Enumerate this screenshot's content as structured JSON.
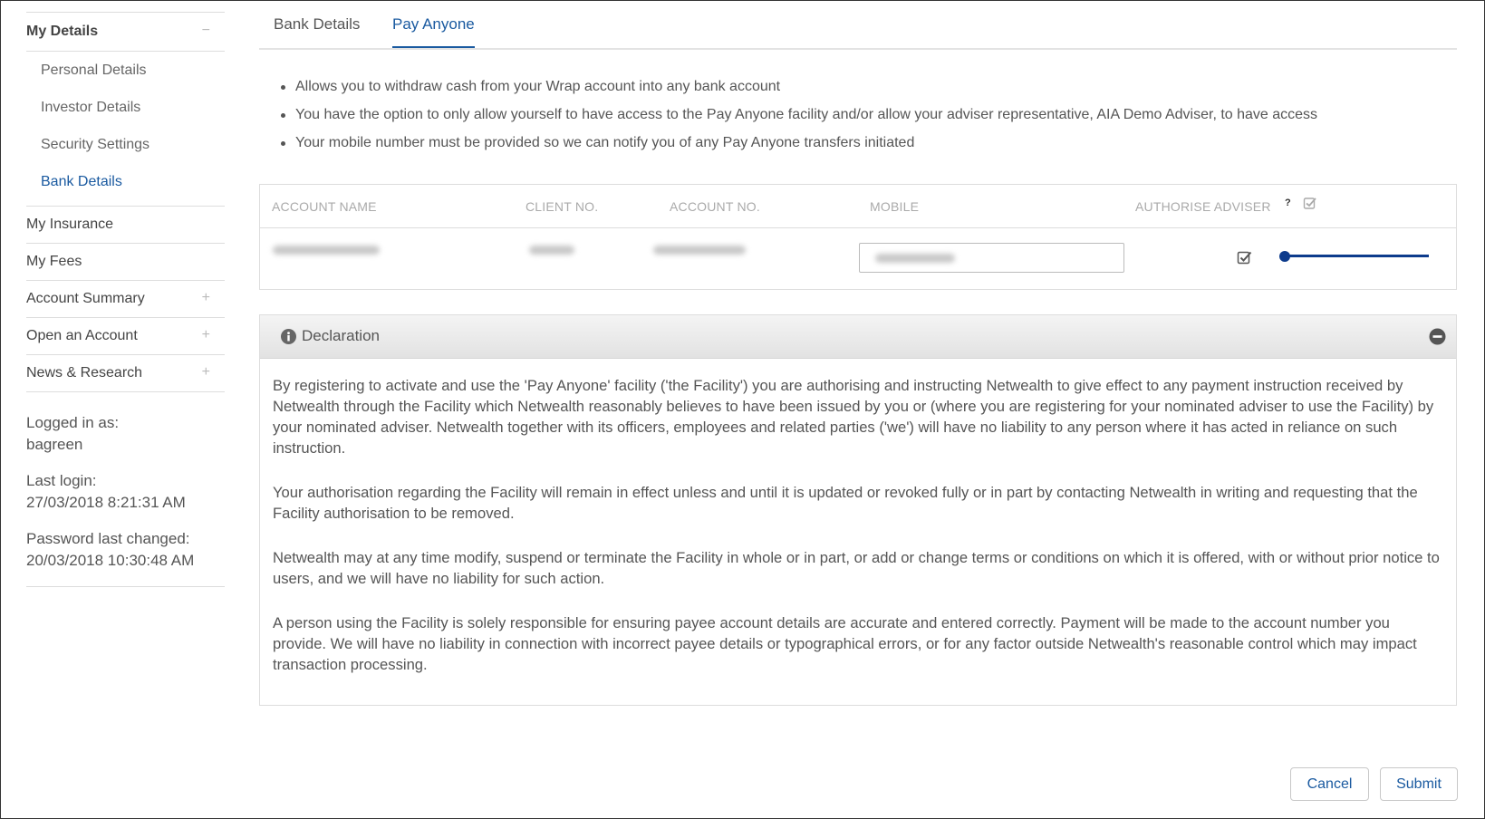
{
  "sidebar": {
    "my_details": {
      "label": "My Details",
      "toggle": "−"
    },
    "sub_items": [
      {
        "label": "Personal Details"
      },
      {
        "label": "Investor Details"
      },
      {
        "label": "Security Settings"
      },
      {
        "label": "Bank Details"
      }
    ],
    "main_items": [
      {
        "label": "My Insurance",
        "toggle": ""
      },
      {
        "label": "My Fees",
        "toggle": ""
      },
      {
        "label": "Account Summary",
        "toggle": "+"
      },
      {
        "label": "Open an Account",
        "toggle": "+"
      },
      {
        "label": "News & Research",
        "toggle": "+"
      }
    ],
    "login": {
      "logged_in_label": "Logged in as:",
      "username": "bagreen",
      "last_login_label": "Last login:",
      "last_login": "27/03/2018 8:21:31 AM",
      "password_changed_label": "Password last changed:",
      "password_changed": "20/03/2018 10:30:48 AM"
    }
  },
  "tabs": [
    {
      "label": "Bank Details"
    },
    {
      "label": "Pay Anyone",
      "active": true
    }
  ],
  "bullets": [
    "Allows you to withdraw cash from your Wrap account into any bank account",
    "You have the option to only allow yourself to have access to the Pay Anyone facility and/or allow your adviser representative, AIA Demo Adviser, to have access",
    "Your mobile number must be provided so we can notify you of any Pay Anyone transfers initiated"
  ],
  "table": {
    "headers": {
      "account_name": "ACCOUNT NAME",
      "client_no": "CLIENT NO.",
      "account_no": "ACCOUNT NO.",
      "mobile": "MOBILE",
      "authorise_adviser": "AUTHORISE ADVISER",
      "help": "?"
    },
    "row": {
      "authorise_checked": true,
      "slider_value": 0
    }
  },
  "declaration": {
    "title": "Declaration",
    "paragraphs": [
      "By registering to activate and use the 'Pay Anyone' facility ('the Facility') you are authorising and instructing Netwealth to give effect to any payment instruction received by Netwealth through the Facility which Netwealth reasonably believes to have been issued by you or (where you are registering for your nominated adviser to use the Facility) by your nominated adviser. Netwealth together with its officers, employees and related parties ('we') will have no liability to any person where it has acted in reliance on such instruction.",
      "Your authorisation regarding the Facility will remain in effect unless and until it is updated or revoked fully or in part by contacting Netwealth in writing and requesting that the Facility authorisation to be removed.",
      "Netwealth may at any time modify, suspend or terminate the Facility in whole or in part, or add or change terms or conditions on which it is offered, with or without prior notice to users, and we will have no liability for such action.",
      "A person using the Facility is solely responsible for ensuring payee account details are accurate and entered correctly. Payment will be made to the account number you provide. We will have no liability in connection with incorrect payee details or typographical errors, or for any factor outside Netwealth's reasonable control which may impact transaction processing."
    ]
  },
  "buttons": {
    "cancel": "Cancel",
    "submit": "Submit"
  },
  "colors": {
    "accent": "#1a5aa0",
    "slider": "#0d3b8c"
  }
}
